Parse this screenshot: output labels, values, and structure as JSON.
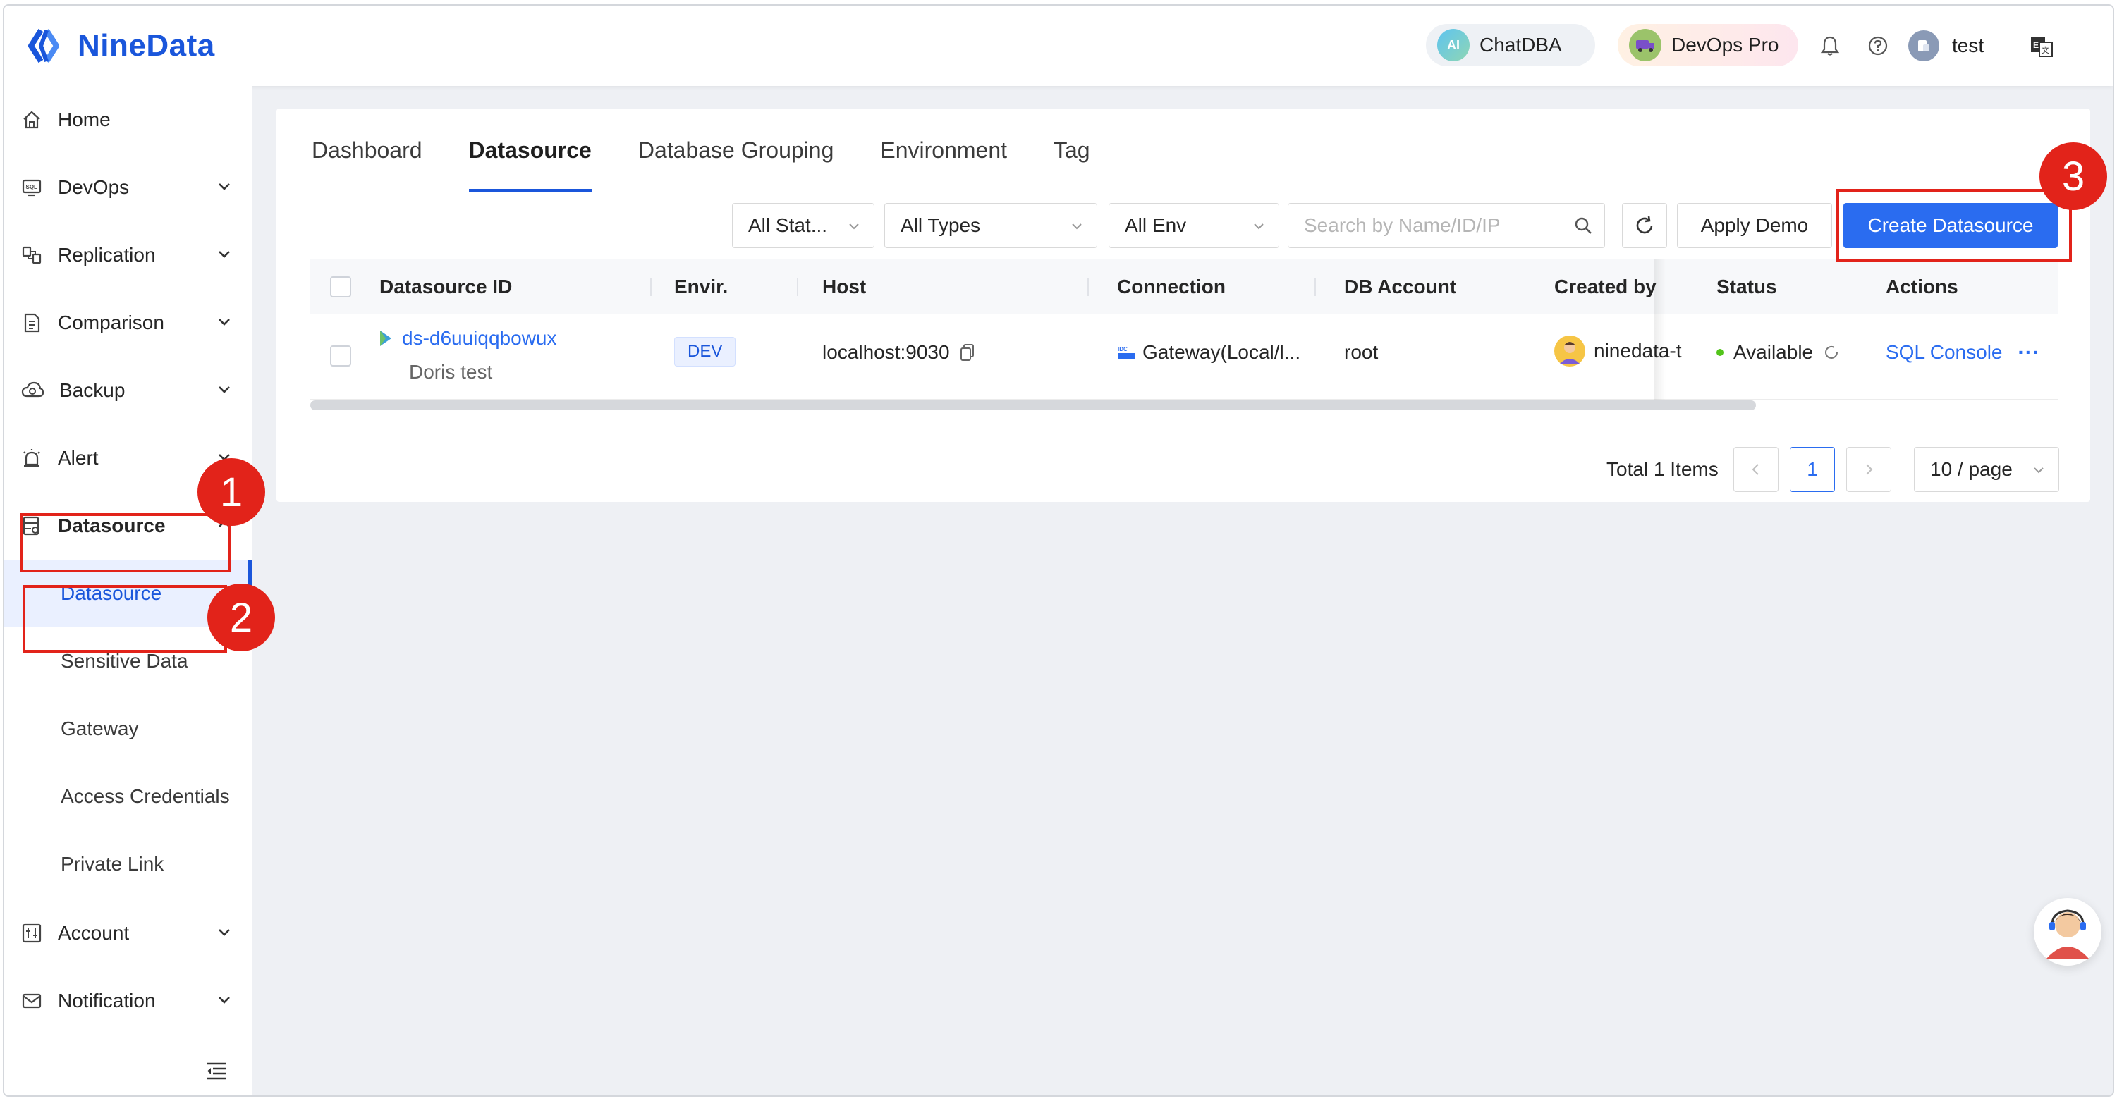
{
  "app": {
    "name": "NineData"
  },
  "header": {
    "chatdba_label": "ChatDBA",
    "chatdba_badge": "AI",
    "devops_label": "DevOps Pro",
    "user_name": "test"
  },
  "sidebar": {
    "items": [
      {
        "label": "Home",
        "icon": "home-icon"
      },
      {
        "label": "DevOps",
        "icon": "sql-icon"
      },
      {
        "label": "Replication",
        "icon": "replication-icon"
      },
      {
        "label": "Comparison",
        "icon": "comparison-icon"
      },
      {
        "label": "Backup",
        "icon": "cloud-backup-icon"
      },
      {
        "label": "Alert",
        "icon": "alarm-icon"
      },
      {
        "label": "Datasource",
        "icon": "datasource-icon"
      },
      {
        "label": "Account",
        "icon": "account-icon"
      },
      {
        "label": "Notification",
        "icon": "mail-icon"
      }
    ],
    "sub_items": [
      {
        "label": "Datasource"
      },
      {
        "label": "Sensitive Data"
      },
      {
        "label": "Gateway"
      },
      {
        "label": "Access Credentials"
      },
      {
        "label": "Private Link"
      }
    ]
  },
  "tabs": [
    "Dashboard",
    "Datasource",
    "Database Grouping",
    "Environment",
    "Tag"
  ],
  "active_tab": "Datasource",
  "filters": {
    "status": "All Stat...",
    "types": "All Types",
    "env": "All Env",
    "search_placeholder": "Search by Name/ID/IP",
    "apply_demo": "Apply Demo",
    "create": "Create Datasource"
  },
  "table": {
    "columns": [
      "Datasource ID",
      "Envir.",
      "Host",
      "Connection",
      "DB Account",
      "Created by",
      "Status",
      "Actions"
    ],
    "rows": [
      {
        "id": "ds-d6uuiqqbowux",
        "name": "Doris test",
        "env": "DEV",
        "host": "localhost:9030",
        "connection": "Gateway(Local/l...",
        "db_account": "root",
        "created_by": "ninedata-t",
        "status": "Available",
        "action": "SQL Console",
        "more": "···"
      }
    ]
  },
  "pagination": {
    "total": "Total 1 Items",
    "current": "1",
    "page_size": "10 / page"
  },
  "annotations": [
    "1",
    "2",
    "3"
  ],
  "colors": {
    "brand": "#1a56db",
    "primary": "#2a6cf0",
    "annotation": "#e2231a",
    "status_ok": "#52c41a"
  }
}
